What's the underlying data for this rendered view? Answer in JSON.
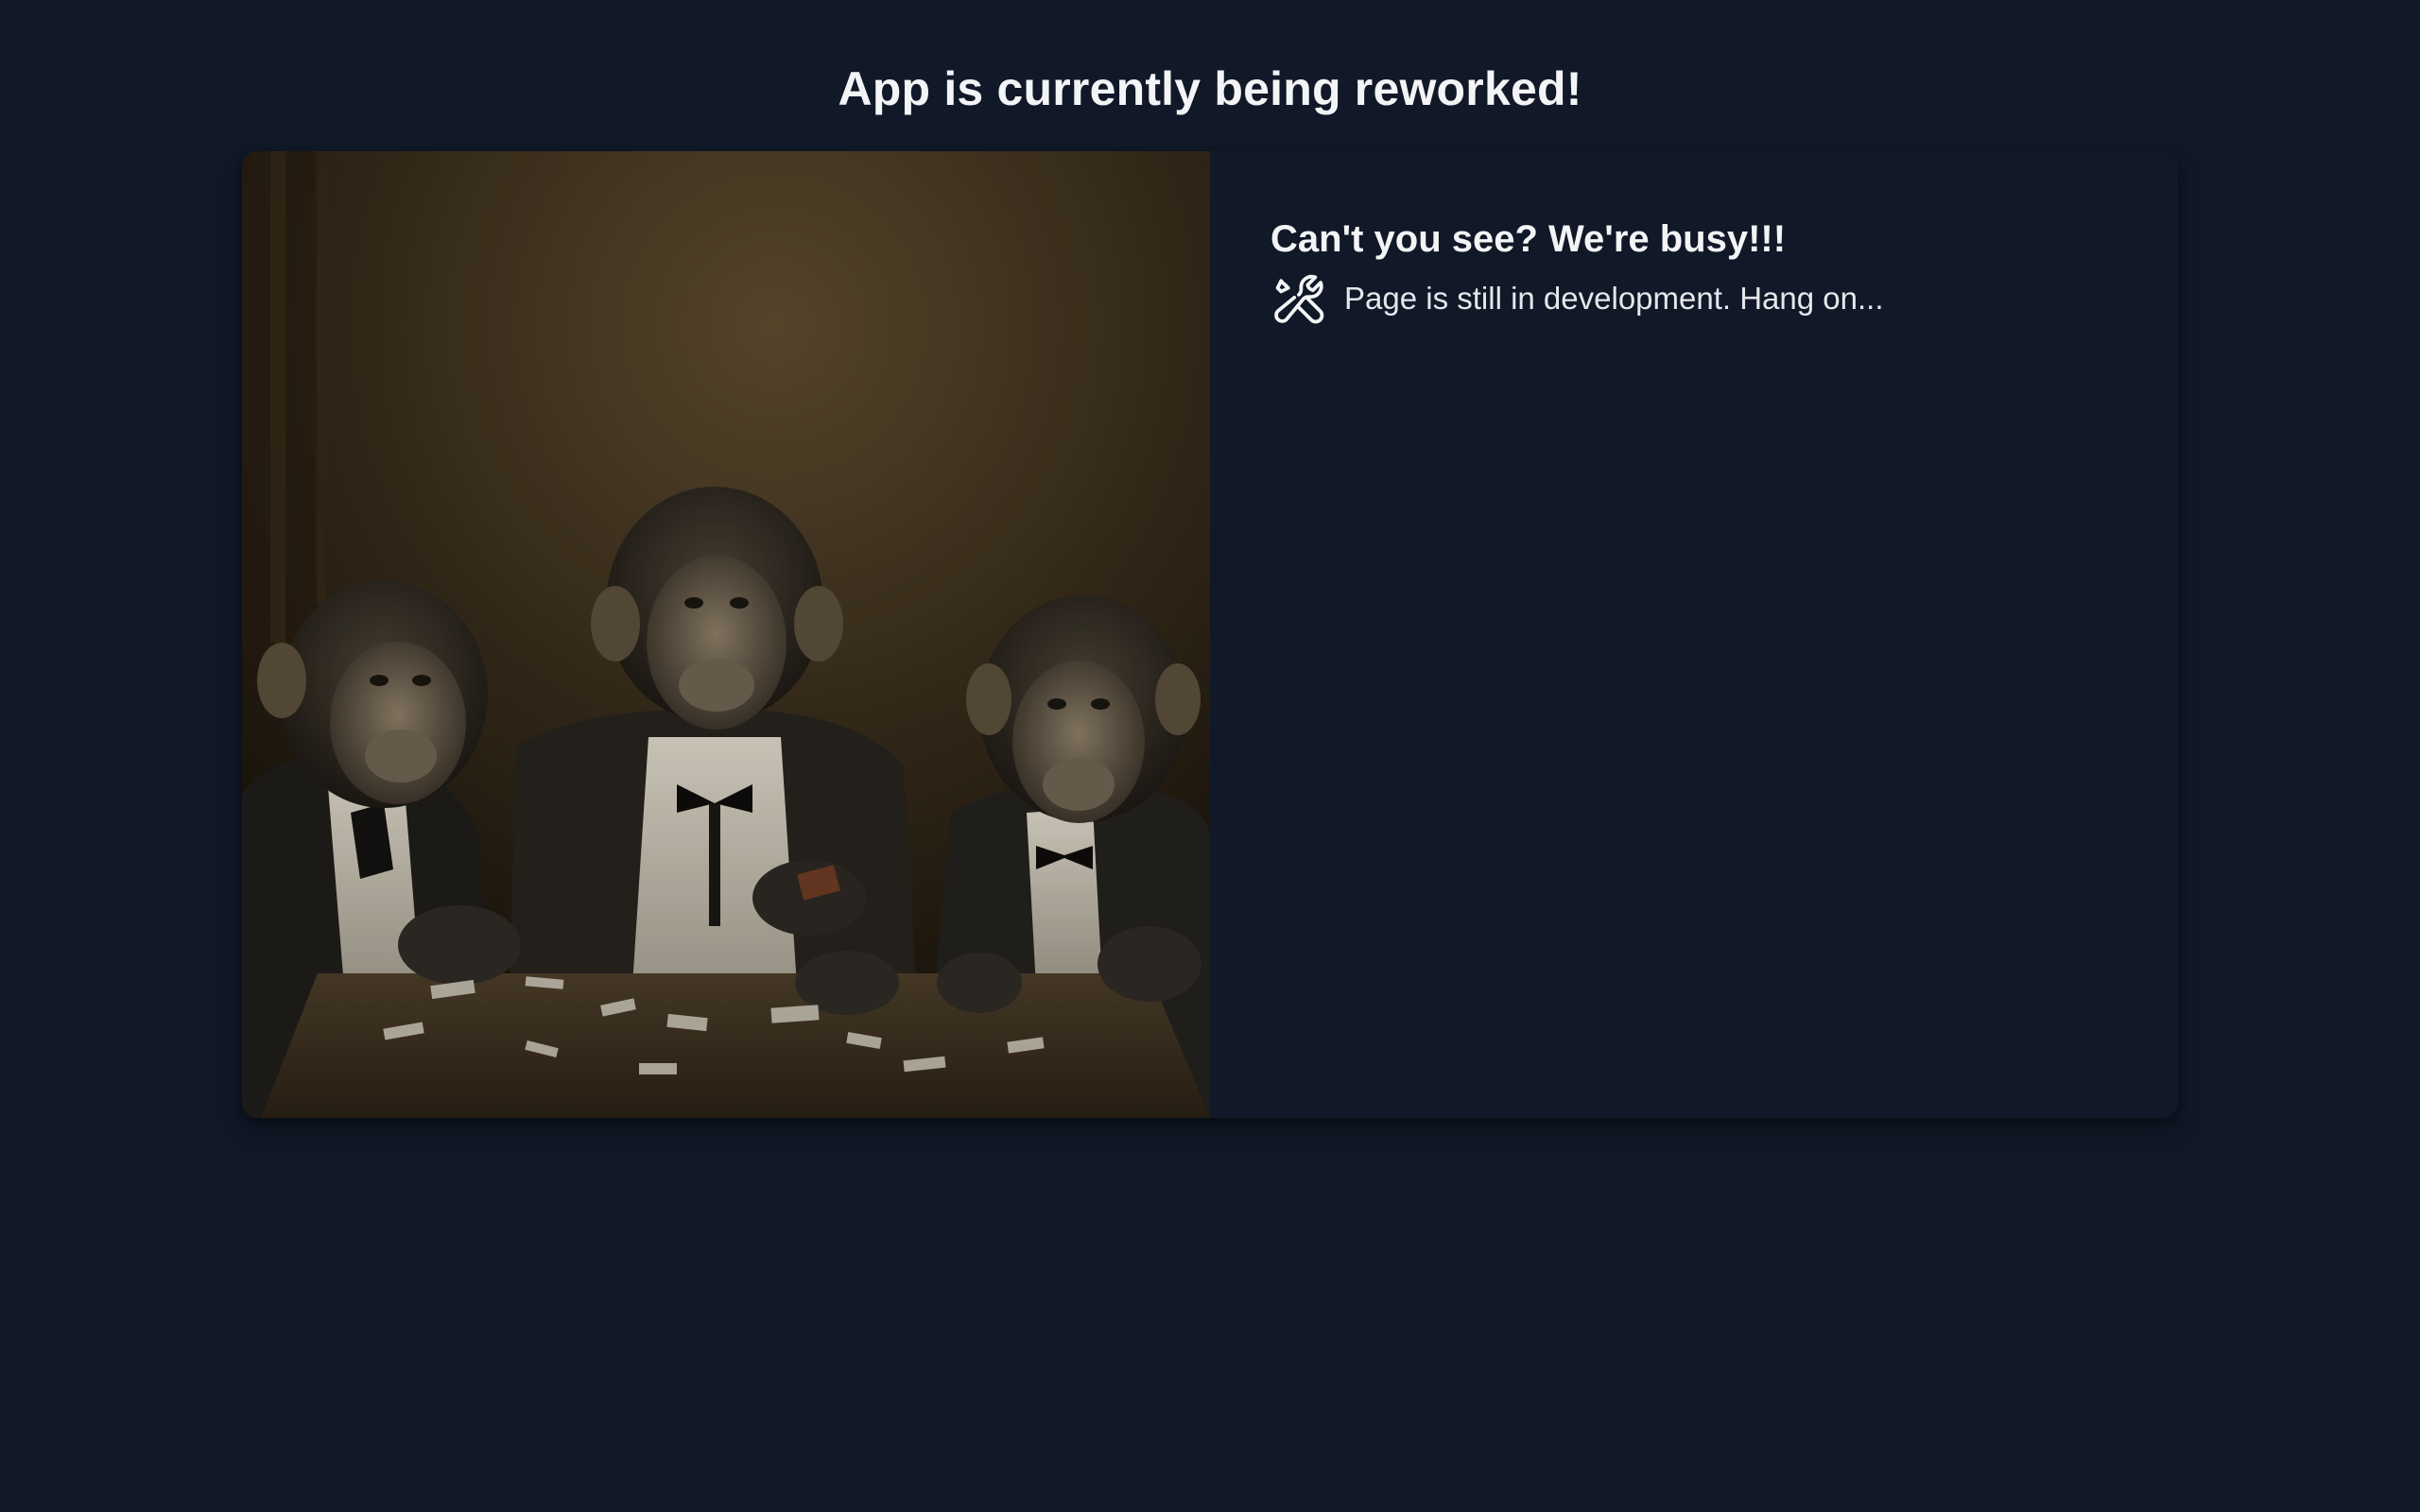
{
  "page": {
    "title": "App is currently being reworked!"
  },
  "card": {
    "image": {
      "subject": "monkeys-playing-cards-photo"
    },
    "title": "Can't you see? We're busy!!!",
    "message": {
      "icon": "wrench-screwdriver-icon",
      "text": "Page is still in development. Hang on..."
    }
  },
  "colors": {
    "background": "#111827",
    "text": "#f3f4f6"
  }
}
